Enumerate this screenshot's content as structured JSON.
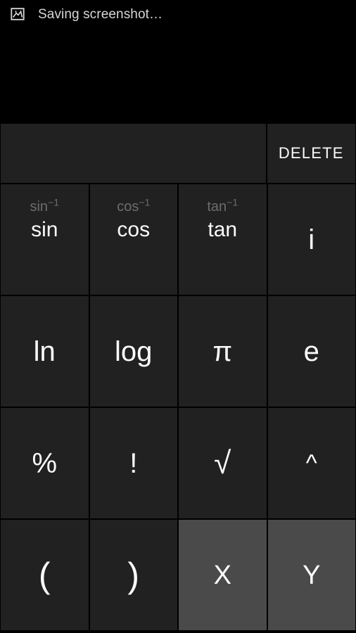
{
  "statusbar": {
    "icon": "image-icon",
    "text": "Saving screenshot…"
  },
  "display": {
    "value": ""
  },
  "keypad": {
    "rows": [
      {
        "name": "display-row",
        "keys": [
          {
            "name": "display-area",
            "label": "",
            "span": 3,
            "style": "blank",
            "interactable": true
          },
          {
            "name": "delete-button",
            "label": "DELETE",
            "span": 1,
            "style": "delete",
            "interactable": true
          }
        ]
      },
      {
        "name": "trig-row",
        "keys": [
          {
            "name": "sin-button",
            "label": "sin",
            "secondary": "sin",
            "secondary_sup": "−1",
            "span": 1,
            "style": "small",
            "interactable": true
          },
          {
            "name": "cos-button",
            "label": "cos",
            "secondary": "cos",
            "secondary_sup": "−1",
            "span": 1,
            "style": "small",
            "interactable": true
          },
          {
            "name": "tan-button",
            "label": "tan",
            "secondary": "tan",
            "secondary_sup": "−1",
            "span": 1,
            "style": "small",
            "interactable": true
          },
          {
            "name": "imaginary-unit-button",
            "label": "i",
            "span": 1,
            "style": "imag",
            "interactable": true
          }
        ]
      },
      {
        "name": "log-constants-row",
        "keys": [
          {
            "name": "ln-button",
            "label": "ln",
            "span": 1,
            "style": "main",
            "interactable": true
          },
          {
            "name": "log-button",
            "label": "log",
            "span": 1,
            "style": "main",
            "interactable": true
          },
          {
            "name": "pi-button",
            "label": "π",
            "span": 1,
            "style": "main",
            "interactable": true
          },
          {
            "name": "e-button",
            "label": "e",
            "span": 1,
            "style": "main",
            "interactable": true
          }
        ]
      },
      {
        "name": "operators-row",
        "keys": [
          {
            "name": "percent-button",
            "label": "%",
            "span": 1,
            "style": "main",
            "interactable": true
          },
          {
            "name": "factorial-button",
            "label": "!",
            "span": 1,
            "style": "bang",
            "interactable": true
          },
          {
            "name": "sqrt-button",
            "label": "√",
            "span": 1,
            "style": "sqrt",
            "interactable": true
          },
          {
            "name": "power-button",
            "label": "^",
            "span": 1,
            "style": "caret",
            "interactable": true
          }
        ]
      },
      {
        "name": "parens-variables-row",
        "keys": [
          {
            "name": "open-paren-button",
            "label": "(",
            "span": 1,
            "style": "paren",
            "interactable": true
          },
          {
            "name": "close-paren-button",
            "label": ")",
            "span": 1,
            "style": "paren",
            "interactable": true
          },
          {
            "name": "variable-x-button",
            "label": "X",
            "span": 1,
            "style": "letter",
            "highlight": true,
            "interactable": true
          },
          {
            "name": "variable-y-button",
            "label": "Y",
            "span": 1,
            "style": "letter",
            "highlight": true,
            "interactable": true
          }
        ]
      }
    ]
  },
  "colors": {
    "background": "#000000",
    "key_face": "#212121",
    "key_highlight": "#4a4a4a",
    "key_text": "#fbfbfb",
    "secondary_text": "#6d6d6d",
    "status_text": "#d6d6d6"
  }
}
